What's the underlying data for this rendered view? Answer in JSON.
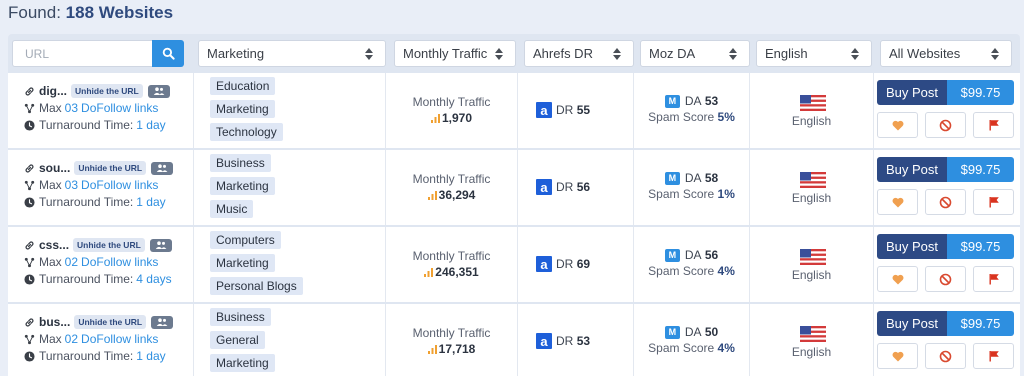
{
  "header": {
    "found_label": "Found:",
    "found_count": "188 Websites"
  },
  "filters": {
    "url_placeholder": "URL",
    "category": "Marketing",
    "traffic": "Monthly Traffic",
    "ahrefs": "Ahrefs DR",
    "moz": "Moz DA",
    "language": "English",
    "websites": "All Websites"
  },
  "labels": {
    "unhide": "Unhide the URL",
    "max": "Max",
    "dofollow": "DoFollow links",
    "turnaround": "Turnaround Time:",
    "monthly_traffic": "Monthly Traffic",
    "dr": "DR",
    "da": "DA",
    "spam_score": "Spam Score",
    "buy_post": "Buy Post",
    "moz_letter": "M",
    "ahrefs_letter": "a"
  },
  "colors": {
    "brand_dark": "#2d4a85",
    "brand_blue": "#2e8fe0",
    "heart": "#f0a050",
    "ban": "#d9492f",
    "flag": "#d9331f"
  },
  "rows": [
    {
      "site": "dig...",
      "max_links": "03",
      "turnaround": "1 day",
      "categories": [
        "Education",
        "Marketing",
        "Technology"
      ],
      "traffic": "1,970",
      "dr": "55",
      "da": "53",
      "spam": "5%",
      "language": "English",
      "price": "$99.75"
    },
    {
      "site": "sou...",
      "max_links": "03",
      "turnaround": "1 day",
      "categories": [
        "Business",
        "Marketing",
        "Music"
      ],
      "traffic": "36,294",
      "dr": "56",
      "da": "58",
      "spam": "1%",
      "language": "English",
      "price": "$99.75"
    },
    {
      "site": "css...",
      "max_links": "02",
      "turnaround": "4 days",
      "categories": [
        "Computers",
        "Marketing",
        "Personal Blogs"
      ],
      "traffic": "246,351",
      "dr": "69",
      "da": "56",
      "spam": "4%",
      "language": "English",
      "price": "$99.75"
    },
    {
      "site": "bus...",
      "max_links": "02",
      "turnaround": "1 day",
      "categories": [
        "Business",
        "General",
        "Marketing"
      ],
      "traffic": "17,718",
      "dr": "53",
      "da": "50",
      "spam": "4%",
      "language": "English",
      "price": "$99.75"
    }
  ]
}
